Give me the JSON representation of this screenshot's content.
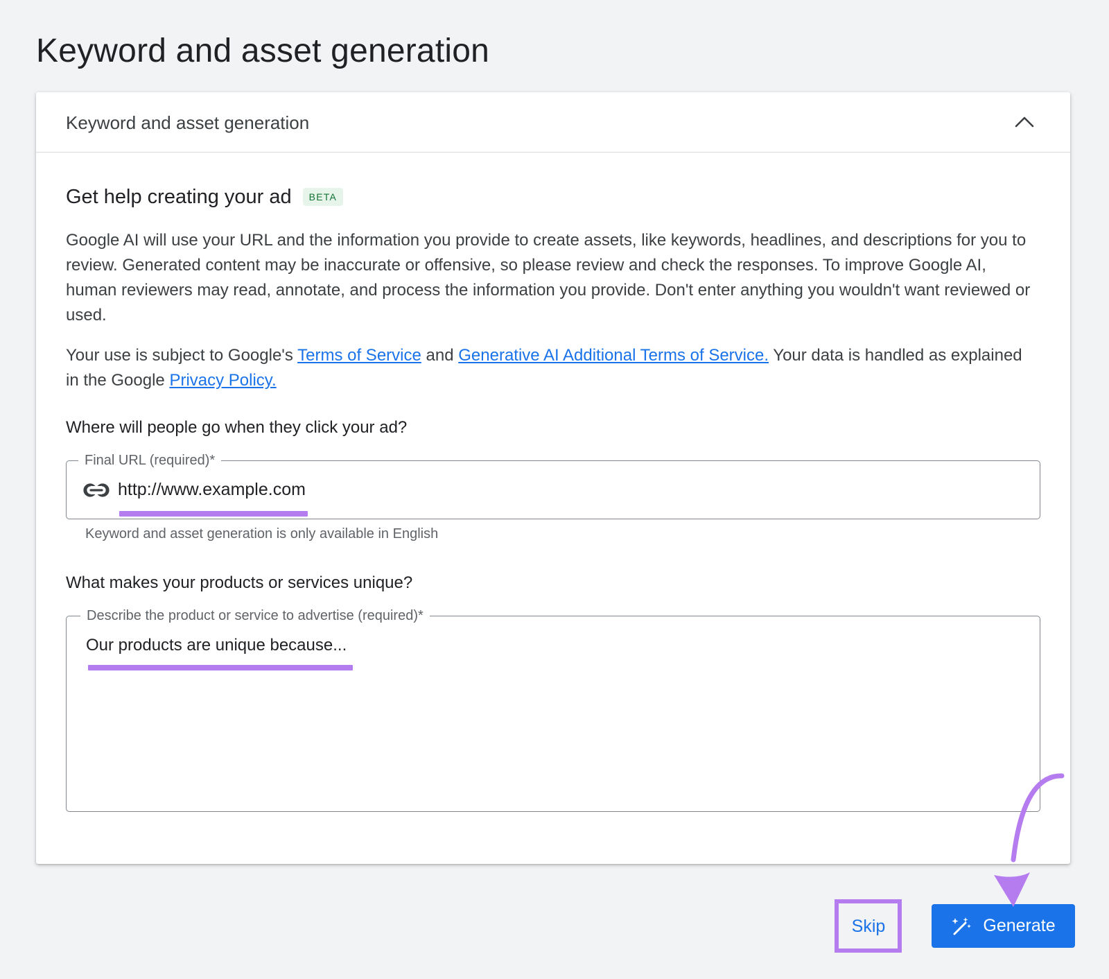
{
  "page": {
    "title": "Keyword and asset generation"
  },
  "card": {
    "header_title": "Keyword and asset generation",
    "section_heading": "Get help creating your ad",
    "beta_badge": "BETA",
    "disclaimer": "Google AI will use your URL and the information you provide to create assets, like keywords, headlines, and descriptions for you to review. Generated content may be inaccurate or offensive, so please review and check the responses. To improve Google AI, human reviewers may read, annotate, and process the information you provide. Don't enter anything you wouldn't want reviewed or used.",
    "terms": {
      "prefix": "Your use is subject to Google's ",
      "tos_link": "Terms of Service",
      "and": " and ",
      "genai_link": "Generative AI Additional Terms of Service.",
      "middle": " Your data is handled as explained in the Google ",
      "privacy_link": "Privacy Policy."
    },
    "url_section": {
      "question": "Where will people go when they click your ad?",
      "label": "Final URL (required)*",
      "value": "http://www.example.com",
      "helper": "Keyword and asset generation is only available in English"
    },
    "unique_section": {
      "question": "What makes your products or services unique?",
      "label": "Describe the product or service to advertise (required)*",
      "value": "Our products are unique because..."
    }
  },
  "actions": {
    "skip_label": "Skip",
    "generate_label": "Generate"
  },
  "colors": {
    "accent": "#1a73e8",
    "annotation": "#b57cf0",
    "beta_bg": "#e6f4ea",
    "beta_text": "#137333"
  },
  "icons": {
    "collapse": "chevron-up-icon",
    "url": "link-icon",
    "generate": "magic-wand-icon"
  }
}
